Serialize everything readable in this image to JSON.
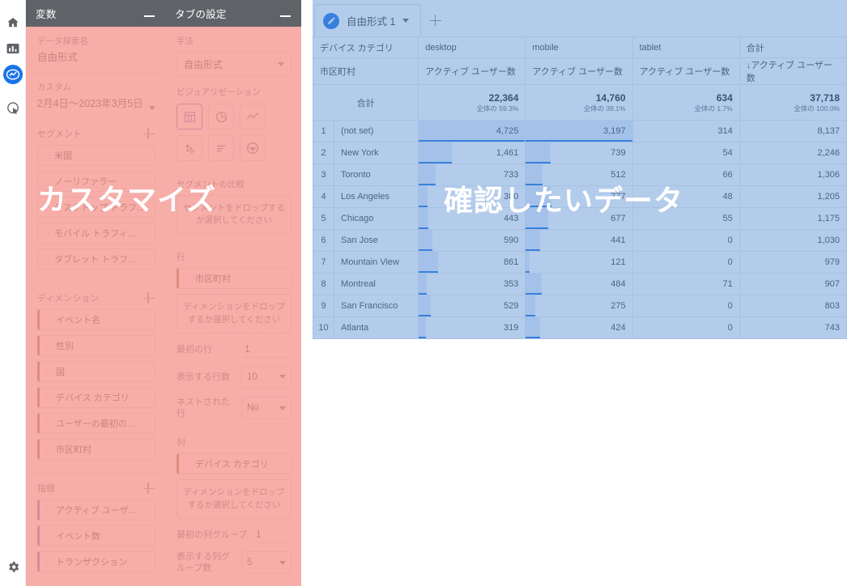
{
  "rail": {
    "items": [
      {
        "name": "home-icon",
        "label": "ホーム"
      },
      {
        "name": "reports-icon",
        "label": "レポート"
      },
      {
        "name": "explore-icon",
        "label": "探索"
      },
      {
        "name": "advertising-icon",
        "label": "広告"
      }
    ],
    "settings_label": "管理"
  },
  "variables_panel": {
    "title": "変数",
    "minimize_label": "−",
    "exploration_name_label": "データ探索名:",
    "exploration_name_value": "自由形式",
    "date_label": "カスタム",
    "date_value": "2月4日〜2023年3月5日",
    "segments": {
      "title": "セグメント",
      "add_label": "+",
      "items": [
        {
          "label": "米国"
        },
        {
          "label": "ノーリファラー"
        },
        {
          "label": "デスクトップ トラフィ…"
        },
        {
          "label": "モバイル トラフィ…"
        },
        {
          "label": "タブレット トラフ…"
        }
      ]
    },
    "dimensions": {
      "title": "ディメンション",
      "add_label": "+",
      "items": [
        {
          "label": "イベント名"
        },
        {
          "label": "性別"
        },
        {
          "label": "国"
        },
        {
          "label": "デバイス カテゴリ"
        },
        {
          "label": "ユーザーの最初の…"
        },
        {
          "label": "市区町村"
        }
      ]
    },
    "metrics": {
      "title": "指標",
      "add_label": "+",
      "items": [
        {
          "label": "アクティブ ユーザ…"
        },
        {
          "label": "イベント数"
        },
        {
          "label": "トランザクション"
        }
      ]
    }
  },
  "tab_settings_panel": {
    "title": "タブの設定",
    "minimize_label": "−",
    "technique_label": "手法",
    "technique_value": "自由形式",
    "visualization_label": "ビジュアリゼーション",
    "visualizations": [
      {
        "name": "table-viz-icon",
        "label": "表",
        "selected": true
      },
      {
        "name": "donut-viz-icon",
        "label": "ドーナツグラフ",
        "selected": false
      },
      {
        "name": "line-viz-icon",
        "label": "折れ線グラフ",
        "selected": false
      },
      {
        "name": "scatter-viz-icon",
        "label": "散布図",
        "selected": false
      },
      {
        "name": "bar-viz-icon",
        "label": "棒グラフ",
        "selected": false
      },
      {
        "name": "geo-viz-icon",
        "label": "地図",
        "selected": false
      }
    ],
    "segment_compare_label": "セグメントの比較",
    "segment_dropzone": "セグメントをドロップするか選択してください",
    "rows_label": "行",
    "rows_chip": "市区町村",
    "rows_dropzone": "ディメンションをドロップするか選択してください",
    "start_row_label": "最初の行",
    "start_row_value": "1",
    "show_rows_label": "表示する行数",
    "show_rows_value": "10",
    "nested_rows_label": "ネストされた行",
    "nested_rows_value": "No",
    "columns_label": "列",
    "columns_chip": "デバイス カテゴリ",
    "columns_dropzone": "ディメンションをドロップするか選択してください",
    "start_colgroup_label": "最初の列グループ",
    "start_colgroup_value": "1",
    "show_colgroups_label": "表示する列グループ数",
    "show_colgroups_value": "5"
  },
  "main": {
    "tab": {
      "label": "自由形式 1",
      "icon": "edit-pencil-icon"
    },
    "add_tab_label": "+"
  },
  "chart_data": {
    "type": "table",
    "title": "自由形式 1",
    "column_dimension_header": "デバイス カテゴリ",
    "row_dimension_header": "市区町村",
    "column_groups": [
      "desktop",
      "mobile",
      "tablet",
      "合計"
    ],
    "metric_headers": [
      "アクティブ ユーザー数",
      "アクティブ ユーザー数",
      "アクティブ ユーザー数",
      "↓アクティブ ユーザー数"
    ],
    "sorted_by": "合計 アクティブ ユーザー数",
    "sort_direction": "desc",
    "totals_label": "合計",
    "totals": [
      {
        "value": "22,364",
        "pct": "全体の 59.3%"
      },
      {
        "value": "14,760",
        "pct": "全体の 39.1%"
      },
      {
        "value": "634",
        "pct": "全体の 1.7%"
      },
      {
        "value": "37,718",
        "pct": "全体の 100.0%"
      }
    ],
    "rows": [
      {
        "rank": "1",
        "city": "(not set)",
        "desktop": "4,725",
        "mobile": "3,197",
        "tablet": "314",
        "total": "8,137"
      },
      {
        "rank": "2",
        "city": "New York",
        "desktop": "1,461",
        "mobile": "739",
        "tablet": "54",
        "total": "2,246"
      },
      {
        "rank": "3",
        "city": "Toronto",
        "desktop": "733",
        "mobile": "512",
        "tablet": "66",
        "total": "1,306"
      },
      {
        "rank": "4",
        "city": "Los Angeles",
        "desktop": "380",
        "mobile": "777",
        "tablet": "48",
        "total": "1,205"
      },
      {
        "rank": "5",
        "city": "Chicago",
        "desktop": "443",
        "mobile": "677",
        "tablet": "55",
        "total": "1,175"
      },
      {
        "rank": "6",
        "city": "San Jose",
        "desktop": "590",
        "mobile": "441",
        "tablet": "0",
        "total": "1,030"
      },
      {
        "rank": "7",
        "city": "Mountain View",
        "desktop": "861",
        "mobile": "121",
        "tablet": "0",
        "total": "979"
      },
      {
        "rank": "8",
        "city": "Montreal",
        "desktop": "353",
        "mobile": "484",
        "tablet": "71",
        "total": "907"
      },
      {
        "rank": "9",
        "city": "San Francisco",
        "desktop": "529",
        "mobile": "275",
        "tablet": "0",
        "total": "803"
      },
      {
        "rank": "10",
        "city": "Atlanta",
        "desktop": "319",
        "mobile": "424",
        "tablet": "0",
        "total": "743"
      }
    ]
  },
  "annotations": {
    "left_caption": "カスタマイズ",
    "right_caption": "確認したいデータ",
    "highlight_left_color": "#f5968f",
    "highlight_right_color": "#5b8fd4"
  }
}
